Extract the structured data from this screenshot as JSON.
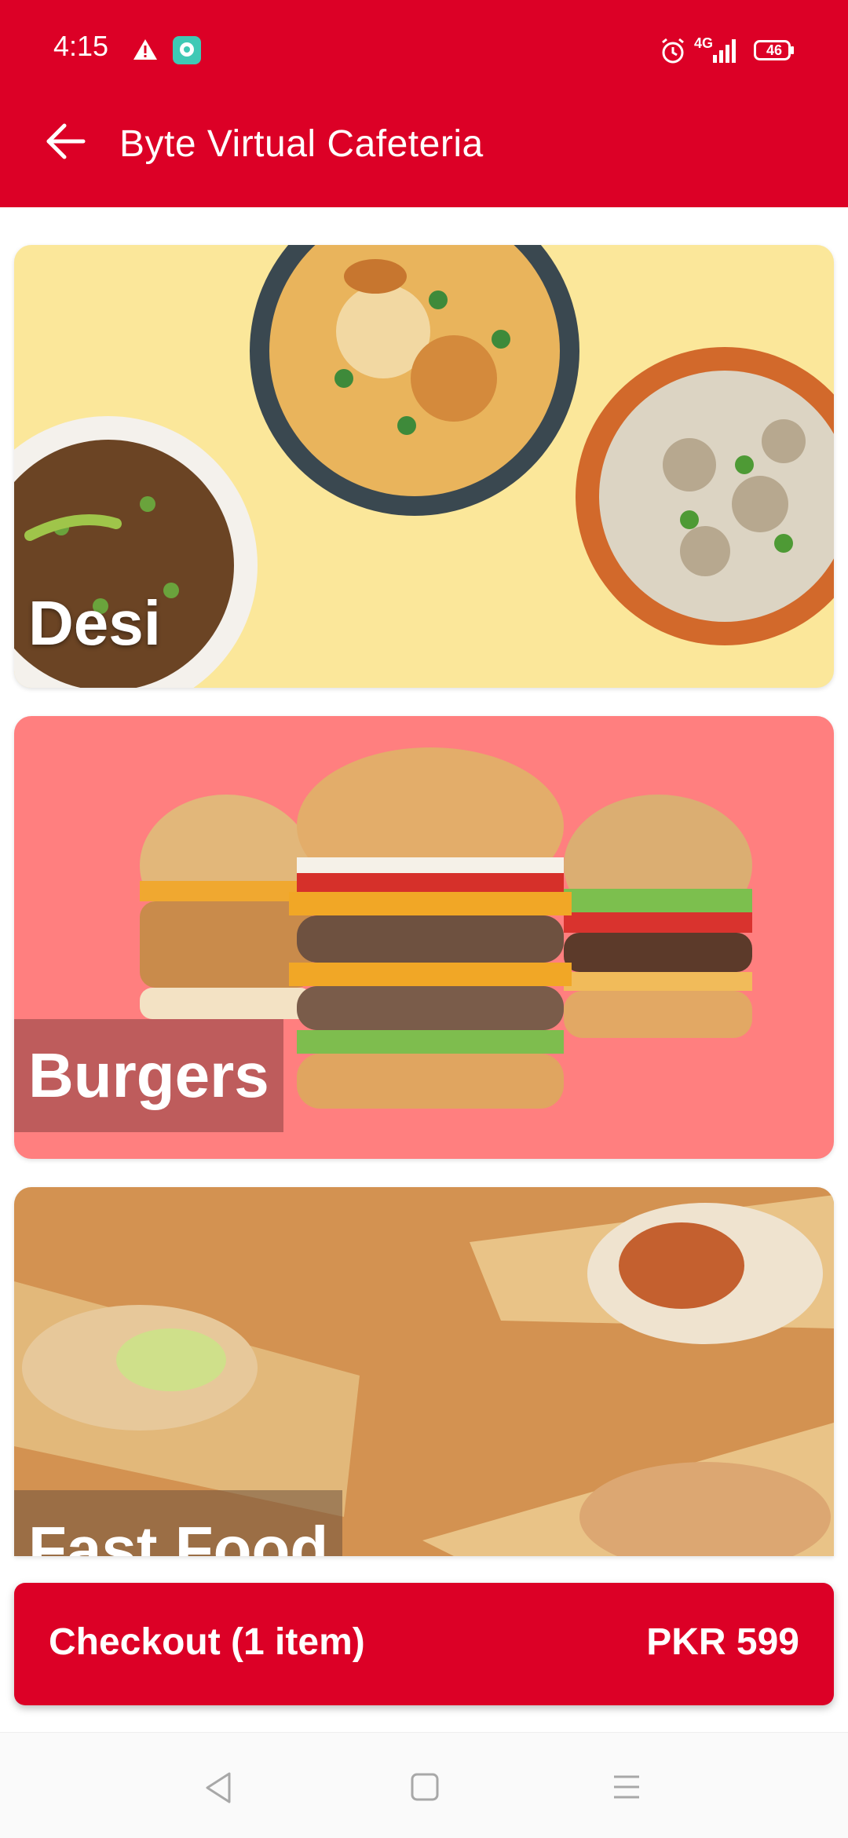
{
  "status_bar": {
    "time": "4:15",
    "network": "4G",
    "battery": "46",
    "icons": [
      "warning-icon",
      "chat-app-icon",
      "alarm-icon",
      "signal-icon",
      "battery-icon"
    ]
  },
  "app_bar": {
    "title": "Byte Virtual Cafeteria",
    "back_icon": "arrow-left-icon"
  },
  "categories": [
    {
      "label": "Desi"
    },
    {
      "label": "Burgers"
    },
    {
      "label": "Fast Food"
    }
  ],
  "checkout": {
    "label": "Checkout (1 item)",
    "price": "PKR 599"
  },
  "nav_bar": {
    "icons": [
      "nav-back-icon",
      "nav-home-icon",
      "nav-recents-icon"
    ]
  },
  "colors": {
    "primary": "#dc0026",
    "desi_bg": "#fbe79a",
    "burgers_bg": "#ff7f7f",
    "fast_food_bg": "#d39251"
  }
}
